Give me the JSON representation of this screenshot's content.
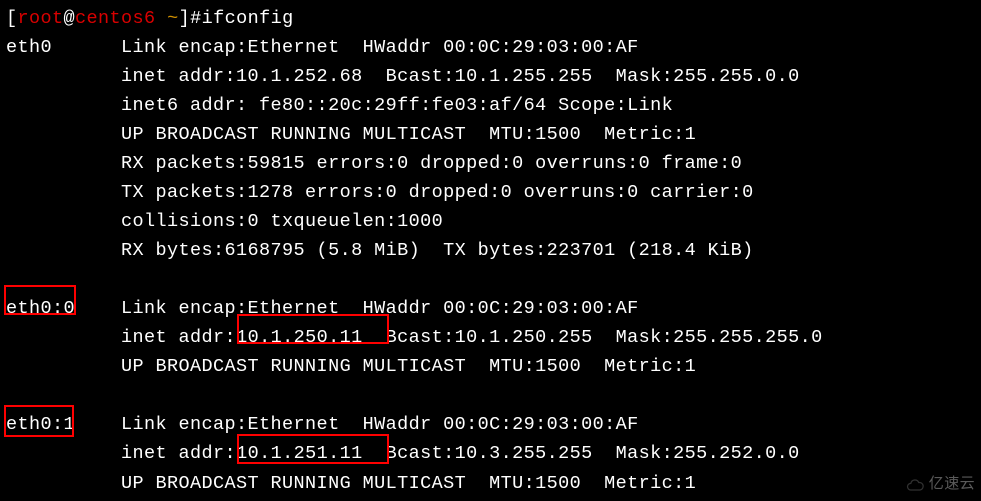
{
  "prompt": {
    "open": "[",
    "user": "root",
    "at": "@",
    "host": "centos6",
    "space": " ",
    "path": "~",
    "close": "]#"
  },
  "command": "ifconfig",
  "eth0": {
    "name": "eth0",
    "l1": "Link encap:Ethernet  HWaddr 00:0C:29:03:00:AF  ",
    "l2": "inet addr:10.1.252.68  Bcast:10.1.255.255  Mask:255.255.0.0",
    "l3": "inet6 addr: fe80::20c:29ff:fe03:af/64 Scope:Link",
    "l4": "UP BROADCAST RUNNING MULTICAST  MTU:1500  Metric:1",
    "l5": "RX packets:59815 errors:0 dropped:0 overruns:0 frame:0",
    "l6": "TX packets:1278 errors:0 dropped:0 overruns:0 carrier:0",
    "l7": "collisions:0 txqueuelen:1000 ",
    "l8": "RX bytes:6168795 (5.8 MiB)  TX bytes:223701 (218.4 KiB)"
  },
  "eth0_0": {
    "name": "eth0:0",
    "l1": "Link encap:Ethernet  HWaddr 00:0C:29:03:00:AF  ",
    "l2a": "inet addr:",
    "l2b": "10.1.250.11",
    "l2c": "  Bcast:10.1.250.255  Mask:255.255.255.0",
    "l3": "UP BROADCAST RUNNING MULTICAST  MTU:1500  Metric:1"
  },
  "eth0_1": {
    "name": "eth0:1",
    "l1": "Link encap:Ethernet  HWaddr 00:0C:29:03:00:AF  ",
    "l2a": "inet addr:",
    "l2b": "10.1.251.11",
    "l2c": "  Bcast:10.3.255.255  Mask:255.252.0.0",
    "l3": "UP BROADCAST RUNNING MULTICAST  MTU:1500  Metric:1"
  },
  "pad": {
    "iface": "          ",
    "indent": "          "
  },
  "watermark": "亿速云"
}
